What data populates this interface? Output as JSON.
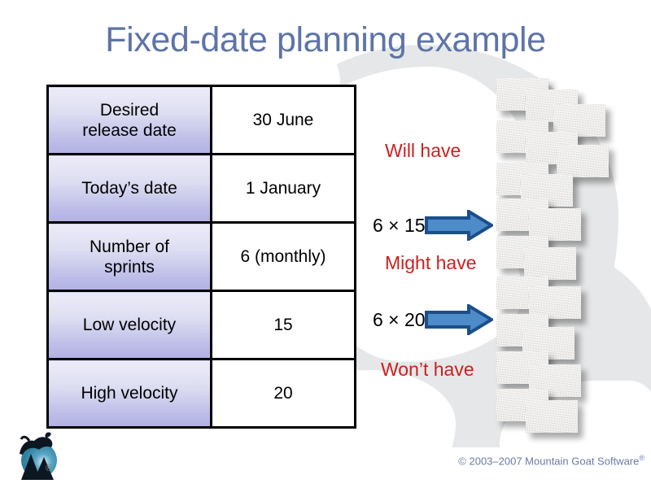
{
  "slide": {
    "title": "Fixed-date planning example"
  },
  "table": {
    "rows": [
      {
        "label": "Desired release date",
        "label_line1": "Desired",
        "label_line2": "release date",
        "value": "30 June"
      },
      {
        "label": "Today's date",
        "label_line1": "Today’s date",
        "label_line2": "",
        "value": "1 January"
      },
      {
        "label": "Number of sprints",
        "label_line1": "Number of",
        "label_line2": "sprints",
        "value": "6 (monthly)"
      },
      {
        "label": "Low velocity",
        "label_line1": "Low velocity",
        "label_line2": "",
        "value": "15"
      },
      {
        "label": "High velocity",
        "label_line1": "High velocity",
        "label_line2": "",
        "value": "20"
      }
    ]
  },
  "callouts": {
    "will_have": "Will have",
    "might_have": "Might have",
    "wont_have": "Won’t have",
    "calc_low": "6 × 15",
    "calc_high": "6 × 20"
  },
  "footer": {
    "copyright": "© 2003–2007 Mountain Goat Software",
    "registered_mark": "®"
  },
  "logo": {
    "name": "mountain-goat-software-logo",
    "registered_mark": "®"
  },
  "colors": {
    "title": "#5e74a8",
    "callout_red": "#cc2020",
    "arrow_fill": "#4e8bc9",
    "arrow_stroke": "#1b4f8a",
    "table_label_gradient_top": "#ececf8",
    "table_label_gradient_bottom": "#b2b2e2",
    "footer_text": "#6b7ba6",
    "background": "#ffffff",
    "blob_grey": "#e6e7e8"
  }
}
